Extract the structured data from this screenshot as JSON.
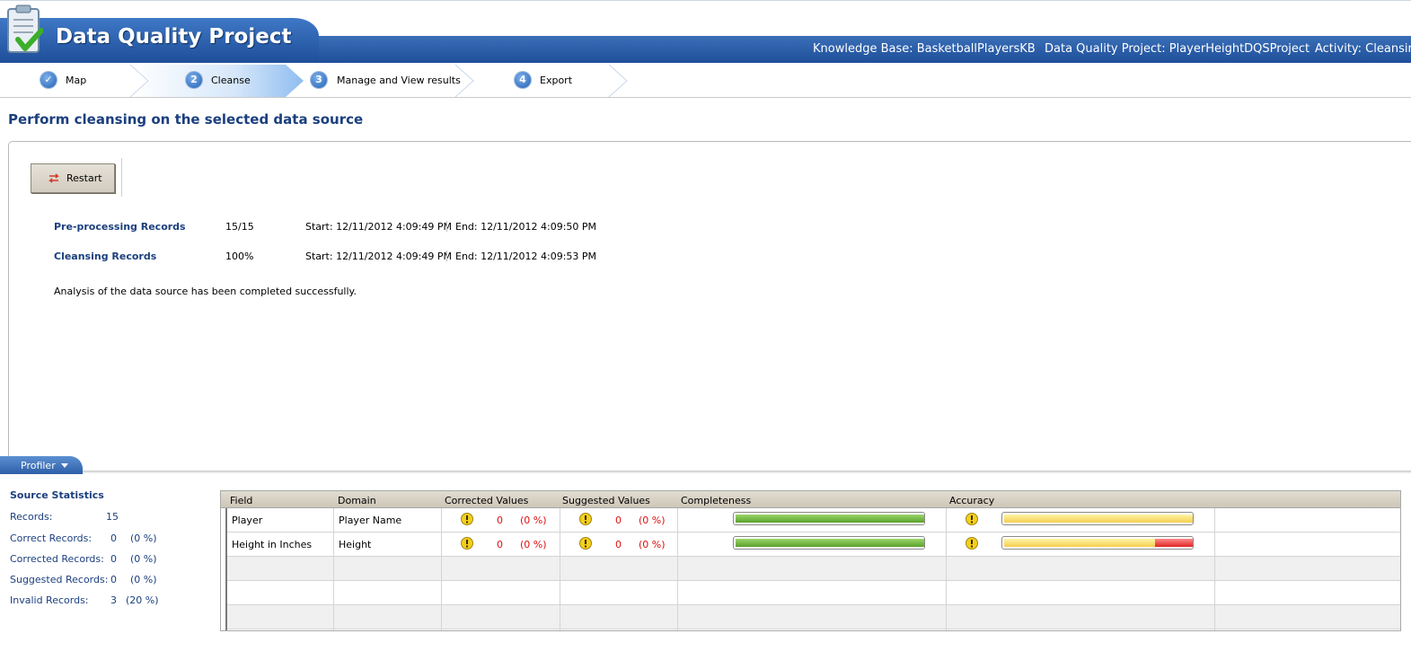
{
  "header": {
    "title": "Data Quality Project",
    "knowledge_base": "Knowledge Base: BasketballPlayersKB",
    "project": "Data Quality Project: PlayerHeightDQSProject",
    "activity": "Activity: Cleansing"
  },
  "steps": [
    {
      "num": "✓",
      "label": "Map"
    },
    {
      "num": "2",
      "label": "Cleanse"
    },
    {
      "num": "3",
      "label": "Manage and View results"
    },
    {
      "num": "4",
      "label": "Export"
    }
  ],
  "main": {
    "heading": "Perform cleansing on the selected data source",
    "restart_label": "Restart",
    "progress": [
      {
        "name": "Pre-processing Records",
        "value": "15/15",
        "start": "Start: 12/11/2012 4:09:49 PM",
        "end": "End: 12/11/2012 4:09:50 PM"
      },
      {
        "name": "Cleansing Records",
        "value": "100%",
        "start": "Start: 12/11/2012 4:09:49 PM",
        "end": "End: 12/11/2012 4:09:53 PM"
      }
    ],
    "status_message": "Analysis of the data source has been completed successfully."
  },
  "profiler": {
    "tab_label": "Profiler",
    "stats_title": "Source Statistics",
    "stats": [
      {
        "label": "Records:",
        "value": "15",
        "pct": ""
      },
      {
        "label": "Correct Records:",
        "value": "0",
        "pct": "(0 %)"
      },
      {
        "label": "Corrected Records:",
        "value": "0",
        "pct": "(0 %)"
      },
      {
        "label": "Suggested Records:",
        "value": "0",
        "pct": "(0 %)"
      },
      {
        "label": "Invalid Records:",
        "value": "3",
        "pct": "(20 %)"
      }
    ],
    "columns": [
      "Field",
      "Domain",
      "Corrected Values",
      "Suggested Values",
      "Completeness",
      "Accuracy"
    ],
    "rows": [
      {
        "field": "Player",
        "domain": "Player Name",
        "corrected": "0",
        "corrected_pct": "(0 %)",
        "suggested": "0",
        "suggested_pct": "(0 %)",
        "completeness": 1.0,
        "accuracy": 1.0
      },
      {
        "field": "Height in Inches",
        "domain": "Height",
        "corrected": "0",
        "corrected_pct": "(0 %)",
        "suggested": "0",
        "suggested_pct": "(0 %)",
        "completeness": 1.0,
        "accuracy": 0.8
      }
    ]
  },
  "colors": {
    "header_blue": "#1f4f9a",
    "heading_text": "#1b3f7e",
    "error_red": "#e01010",
    "bar_green": "#5aa12c",
    "bar_yellow": "#f5cf4f",
    "bar_red": "#e02525"
  },
  "icons": [
    "clipboard-check-icon",
    "checkmark-icon",
    "restart-icon",
    "warning-icon",
    "dropdown-arrow-icon"
  ]
}
